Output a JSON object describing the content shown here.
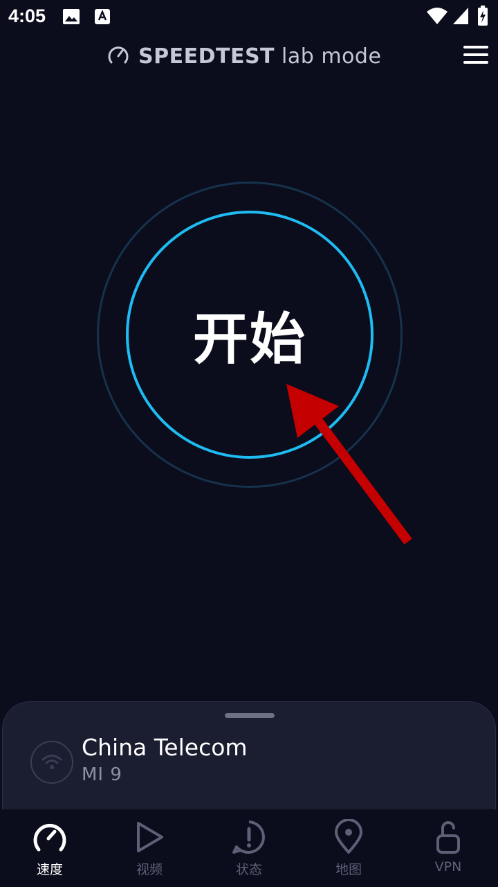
{
  "status_bar": {
    "time": "4:05",
    "left_icons": [
      "image-icon",
      "text-a-icon"
    ],
    "right_icons": [
      "wifi-icon",
      "cell-signal-icon",
      "battery-charging-icon"
    ]
  },
  "header": {
    "title_bold": "SPEEDTEST",
    "title_light": " lab mode",
    "logo_icon": "speedometer-icon",
    "menu_icon": "hamburger-menu-icon"
  },
  "go_button": {
    "label": "开始",
    "ring_color": "#1fbcf3",
    "outer_ring_color": "#16324d"
  },
  "connection": {
    "provider": "China Telecom",
    "device": "MI 9",
    "icon": "wifi-icon"
  },
  "nav": {
    "items": [
      {
        "label": "速度",
        "icon": "speedometer-icon",
        "active": true
      },
      {
        "label": "视频",
        "icon": "play-icon",
        "active": false
      },
      {
        "label": "状态",
        "icon": "alert-icon",
        "active": false
      },
      {
        "label": "地图",
        "icon": "map-pin-icon",
        "active": false
      },
      {
        "label": "VPN",
        "icon": "unlock-icon",
        "active": false
      }
    ]
  },
  "colors": {
    "background": "#0b0d1c",
    "sheet": "#1b1d31",
    "accent": "#1fbcf3",
    "annotation_arrow": "#c40000"
  }
}
